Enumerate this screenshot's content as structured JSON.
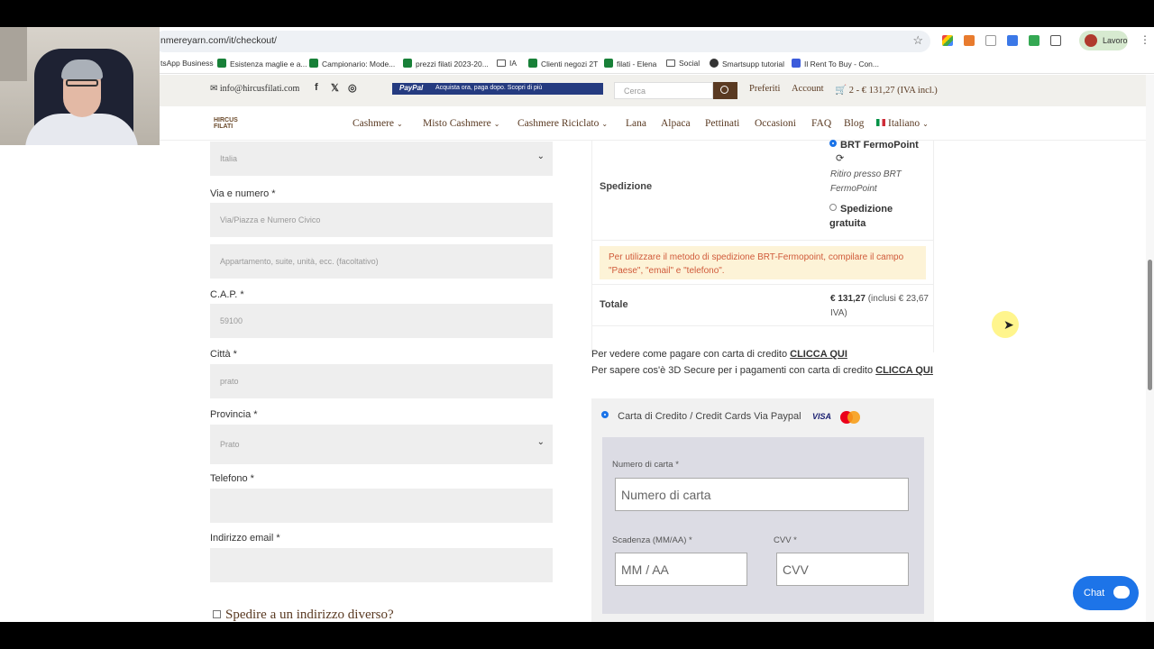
{
  "browser": {
    "url": "nmereyarn.com/it/checkout/",
    "profile_label": "Lavoro",
    "bookmarks": [
      {
        "label": "tsApp Business",
        "icon": "none"
      },
      {
        "label": "Esistenza maglie e a...",
        "icon": "sheet"
      },
      {
        "label": "Campionario: Mode...",
        "icon": "sheet"
      },
      {
        "label": "prezzi filati 2023-20...",
        "icon": "sheet"
      },
      {
        "label": "IA",
        "icon": "folder"
      },
      {
        "label": "Clienti negozi 2T",
        "icon": "sheet"
      },
      {
        "label": "filati - Elena",
        "icon": "sheet"
      },
      {
        "label": "Social",
        "icon": "folder"
      },
      {
        "label": "Smartsupp tutorial",
        "icon": "round"
      },
      {
        "label": "Il Rent To Buy - Con...",
        "icon": "blue"
      }
    ]
  },
  "site": {
    "email": "info@hircusfilati.com",
    "paypal_banner": "Acquista ora, paga dopo. Scopri di più",
    "paypal_logo": "PayPal",
    "search_placeholder": "Cerca",
    "preferiti": "Preferiti",
    "account": "Account",
    "cart": "2 - € 131,27 (IVA incl.)",
    "logo_text": "HIRCUS FILATI",
    "nav": [
      "Cashmere",
      "Misto Cashmere",
      "Cashmere Riciclato",
      "Lana",
      "Alpaca",
      "Pettinati",
      "Occasioni",
      "FAQ",
      "Blog",
      "Italiano"
    ]
  },
  "form": {
    "country_value": "Italia",
    "street_label": "Via e numero *",
    "street_placeholder": "Via/Piazza e Numero Civico",
    "apt_placeholder": "Appartamento, suite, unità, ecc. (facoltativo)",
    "cap_label": "C.A.P. *",
    "cap_value": "59100",
    "city_label": "Città *",
    "city_value": "prato",
    "province_label": "Provincia *",
    "province_value": "Prato",
    "phone_label": "Telefono *",
    "phone_value": "",
    "email_label": "Indirizzo email *",
    "email_value": "",
    "diff_ship": "Spedire a un indirizzo diverso?"
  },
  "order": {
    "shipping_label": "Spedizione",
    "opt1": "BRT FermoPoint",
    "opt1_note": "Ritiro presso BRT FermoPoint",
    "opt2": "Spedizione gratuita",
    "notice": "Per utilizzare il metodo di spedizione BRT-Fermopoint, compilare il campo \"Paese\", \"email\" e \"telefono\".",
    "total_label": "Totale",
    "total_value": "€ 131,27",
    "total_tax": "(inclusi € 23,67 IVA)",
    "info1_text": "Per vedere come pagare con carta di credito",
    "info1_link": "CLICCA QUI",
    "info2_text": "Per sapere cos'è 3D Secure per i pagamenti con carta di credito",
    "info2_link": "CLICCA QUI"
  },
  "payment": {
    "method": "Carta di Credito / Credit Cards Via Paypal",
    "visa": "VISA",
    "card_number_label": "Numero di carta *",
    "card_number_placeholder": "Numero di carta",
    "expiry_label": "Scadenza (MM/AA) *",
    "expiry_placeholder": "MM / AA",
    "cvv_label": "CVV *",
    "cvv_placeholder": "CVV"
  },
  "chat_label": "Chat",
  "colors": {
    "accent_brown": "#5a3a22",
    "notice_bg": "#fdf3d7",
    "chat_blue": "#1d74e8"
  }
}
